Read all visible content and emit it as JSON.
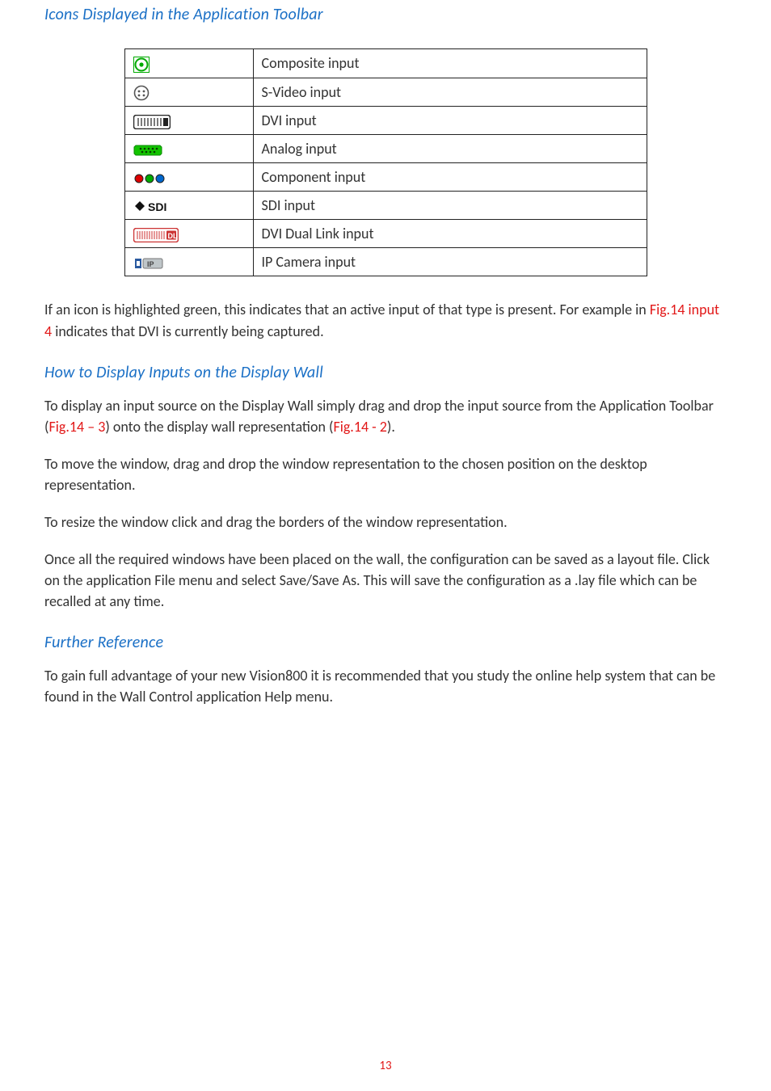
{
  "headings": {
    "icons": "Icons Displayed in the Application Toolbar",
    "display": "How to Display Inputs on the Display Wall",
    "further": "Further Reference"
  },
  "icon_table": [
    {
      "name": "composite-icon",
      "label": "Composite input"
    },
    {
      "name": "svideo-icon",
      "label": "S-Video input"
    },
    {
      "name": "dvi-icon",
      "label": "DVI input"
    },
    {
      "name": "analog-icon",
      "label": "Analog input"
    },
    {
      "name": "component-icon",
      "label": "Component input"
    },
    {
      "name": "sdi-icon",
      "label": "SDI input"
    },
    {
      "name": "dvi-dl-icon",
      "label": "DVI Dual Link input"
    },
    {
      "name": "ipcam-icon",
      "label": "IP Camera input"
    }
  ],
  "para": {
    "p1a": "If an icon is highlighted green, this indicates that an active input of that type is present.  For example in ",
    "p1red": "Fig.14 input 4",
    "p1b": " indicates that DVI is currently being captured.",
    "p2a": "To display an input source on the Display Wall simply drag and drop the input source from the Application Toolbar (",
    "p2red1": "Fig.14 – 3",
    "p2mid": ") onto the display wall representation (",
    "p2red2": "Fig.14 - 2",
    "p2end": ").",
    "p3": "To move the window, drag and drop the window representation to the chosen position on the desktop representation.",
    "p4": "To resize the window click and drag the borders of the window representation.",
    "p5": "Once all the required windows have been placed on the wall, the configuration can be saved as a layout file.  Click on the application File menu and select Save/Save As.  This will save the configuration as a .lay file which can be recalled at any time.",
    "p6": "To gain full advantage of your new Vision800 it is recommended that you study the online help system that can be found in the Wall Control application Help menu."
  },
  "page_number": "13"
}
